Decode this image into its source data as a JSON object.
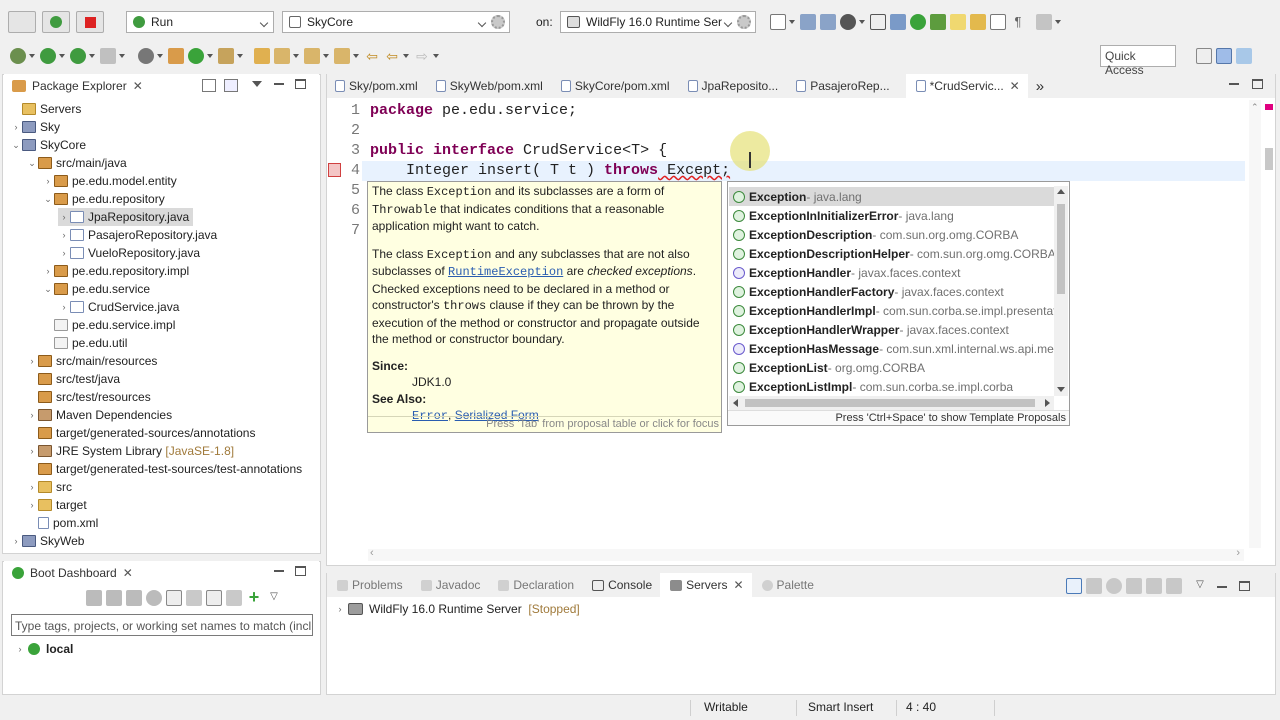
{
  "toolbar": {
    "run_label": "Run",
    "project_label": "SkyCore",
    "on_label": "on:",
    "server_label": "WildFly 16.0 Runtime Ser",
    "quick_access": "Quick Access"
  },
  "package_explorer": {
    "title": "Package Explorer",
    "items": [
      {
        "label": "Servers"
      },
      {
        "label": "Sky"
      },
      {
        "label": "SkyCore"
      },
      {
        "label": "src/main/java"
      },
      {
        "label": "pe.edu.model.entity"
      },
      {
        "label": "pe.edu.repository"
      },
      {
        "label": "JpaRepository.java"
      },
      {
        "label": "PasajeroRepository.java"
      },
      {
        "label": "VueloRepository.java"
      },
      {
        "label": "pe.edu.repository.impl"
      },
      {
        "label": "pe.edu.service"
      },
      {
        "label": "CrudService.java"
      },
      {
        "label": "pe.edu.service.impl"
      },
      {
        "label": "pe.edu.util"
      },
      {
        "label": "src/main/resources"
      },
      {
        "label": "src/test/java"
      },
      {
        "label": "src/test/resources"
      },
      {
        "label": "Maven Dependencies"
      },
      {
        "label": "target/generated-sources/annotations"
      },
      {
        "label": "JRE System Library",
        "suffix": "[JavaSE-1.8]"
      },
      {
        "label": "target/generated-test-sources/test-annotations"
      },
      {
        "label": "src"
      },
      {
        "label": "target"
      },
      {
        "label": "pom.xml"
      },
      {
        "label": "SkyWeb"
      }
    ]
  },
  "editor": {
    "tabs": [
      {
        "label": "Sky/pom.xml"
      },
      {
        "label": "SkyWeb/pom.xml"
      },
      {
        "label": "SkyCore/pom.xml"
      },
      {
        "label": "JpaReposito..."
      },
      {
        "label": "PasajeroRep..."
      },
      {
        "label": "*CrudServic..."
      }
    ],
    "overflow": "»",
    "line_numbers": [
      "1",
      "2",
      "3",
      "4",
      "5",
      "6",
      "7"
    ],
    "line1_kw": "package",
    "line1_rest": " pe.edu.service;",
    "line3_kw1": "public",
    "line3_kw2": "interface",
    "line3_rest": " CrudService<T> {",
    "line4_a": "    Integer insert( T t ) ",
    "line4_kw": "throws",
    "line4_b": " Except;"
  },
  "javadoc": {
    "p1_a": "The class ",
    "p1_code1": "Exception",
    "p1_b": " and its subclasses are a form of ",
    "p1_code2": "Throwable",
    "p1_c": " that indicates conditions that a reasonable application might want to catch.",
    "p2_a": "The class ",
    "p2_code1": "Exception",
    "p2_b": " and any subclasses that are not also subclasses of ",
    "p2_link": "RuntimeException",
    "p2_c": " are ",
    "p2_em": "checked exceptions",
    "p2_d": ". Checked exceptions need to be declared in a method or constructor's ",
    "p2_code2": "throws",
    "p2_e": " clause if they can be thrown by the execution of the method or constructor and propagate outside the method or constructor boundary.",
    "since_label": "Since:",
    "since_value": "JDK1.0",
    "see_label": "See Also:",
    "see_link1": "Error",
    "see_sep": ", ",
    "see_link2": "Serialized Form",
    "footer": "Press 'Tab' from proposal table or click for focus"
  },
  "proposals": {
    "items": [
      {
        "name": "Exception",
        "pkg": " - java.lang"
      },
      {
        "name": "ExceptionInInitializerError",
        "pkg": " - java.lang"
      },
      {
        "name": "ExceptionDescription",
        "pkg": " - com.sun.org.omg.CORBA"
      },
      {
        "name": "ExceptionDescriptionHelper",
        "pkg": " - com.sun.org.omg.CORBA"
      },
      {
        "name": "ExceptionHandler",
        "pkg": " - javax.faces.context"
      },
      {
        "name": "ExceptionHandlerFactory",
        "pkg": " - javax.faces.context"
      },
      {
        "name": "ExceptionHandlerImpl",
        "pkg": " - com.sun.corba.se.impl.presentat"
      },
      {
        "name": "ExceptionHandlerWrapper",
        "pkg": " - javax.faces.context"
      },
      {
        "name": "ExceptionHasMessage",
        "pkg": " - com.sun.xml.internal.ws.api.mes"
      },
      {
        "name": "ExceptionList",
        "pkg": " - org.omg.CORBA"
      },
      {
        "name": "ExceptionListImpl",
        "pkg": " - com.sun.corba.se.impl.corba"
      }
    ],
    "footer": "Press 'Ctrl+Space' to show Template Proposals"
  },
  "boot_dashboard": {
    "title": "Boot Dashboard",
    "filter_placeholder": "Type tags, projects, or working set names to match (incl.",
    "local_label": "local"
  },
  "bottom_panel": {
    "tabs": [
      {
        "label": "Problems"
      },
      {
        "label": "Javadoc"
      },
      {
        "label": "Declaration"
      },
      {
        "label": "Console"
      },
      {
        "label": "Servers"
      },
      {
        "label": "Palette"
      }
    ],
    "server_name": "WildFly 16.0 Runtime Server",
    "server_status": "[Stopped]"
  },
  "status_bar": {
    "writable": "Writable",
    "insert_mode": "Smart Insert",
    "position": "4 : 40"
  }
}
